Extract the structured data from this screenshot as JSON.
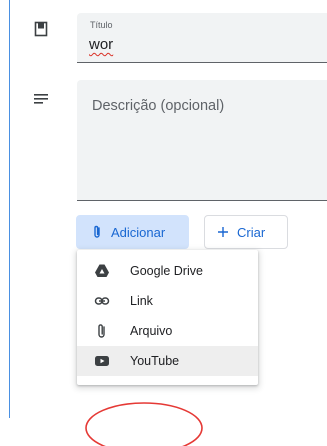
{
  "form": {
    "title_label": "Título",
    "title_value": "wor",
    "description_placeholder": "Descrição (opcional)"
  },
  "buttons": {
    "add_label": "Adicionar",
    "create_label": "Criar"
  },
  "attach_menu": {
    "items": [
      {
        "label": "Google Drive",
        "icon": "google-drive-icon"
      },
      {
        "label": "Link",
        "icon": "link-icon"
      },
      {
        "label": "Arquivo",
        "icon": "paperclip-icon"
      },
      {
        "label": "YouTube",
        "icon": "youtube-icon",
        "highlighted": true
      }
    ]
  },
  "colors": {
    "accent": "#1967d2",
    "add_button_bg": "#d2e3fc",
    "field_bg": "#f1f3f4",
    "annotation": "#e53935"
  }
}
